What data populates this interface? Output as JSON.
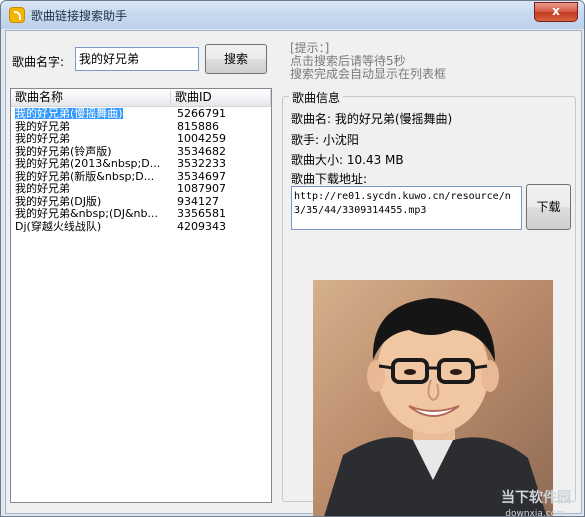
{
  "window": {
    "title": "歌曲链接搜索助手",
    "close_symbol": "x"
  },
  "search": {
    "label": "歌曲名字:",
    "value": "我的好兄弟",
    "button": "搜索"
  },
  "hint": {
    "line1": "[提示：]",
    "line2": "点击搜索后请等待5秒",
    "line3": "搜索完成会自动显示在列表框"
  },
  "list": {
    "columns": [
      "歌曲名称",
      "歌曲ID"
    ],
    "rows": [
      {
        "name": "我的好兄弟(慢摇舞曲)",
        "id": "5266791",
        "selected": true
      },
      {
        "name": "我的好兄弟",
        "id": "815886"
      },
      {
        "name": "我的好兄弟",
        "id": "1004259"
      },
      {
        "name": "我的好兄弟(铃声版)",
        "id": "3534682"
      },
      {
        "name": "我的好兄弟(2013&nbsp;D...",
        "id": "3532233"
      },
      {
        "name": "我的好兄弟(新版&nbsp;D...",
        "id": "3534697"
      },
      {
        "name": "我的好兄弟",
        "id": "1087907"
      },
      {
        "name": "我的好兄弟(DJ版)",
        "id": "934127"
      },
      {
        "name": "我的好兄弟&nbsp;(DJ&nb...",
        "id": "3356581"
      },
      {
        "name": "Dj(穿越火线战队)",
        "id": "4209343"
      }
    ]
  },
  "info": {
    "group_title": "歌曲信息",
    "song_name": "歌曲名: 我的好兄弟(慢摇舞曲)",
    "singer": "歌手: 小沈阳",
    "size": "歌曲大小: 10.43 MB",
    "download_label": "歌曲下载地址:",
    "url": "http://re01.sycdn.kuwo.cn/resource/n3/35/44/3309314455.mp3",
    "download_button": "下载"
  },
  "watermark": {
    "text": "当下软件园",
    "sub": "downxia.com"
  },
  "colors": {
    "selection": "#3399ff",
    "close_button": "#c8452c",
    "title_bar": "#c7d9ee"
  }
}
